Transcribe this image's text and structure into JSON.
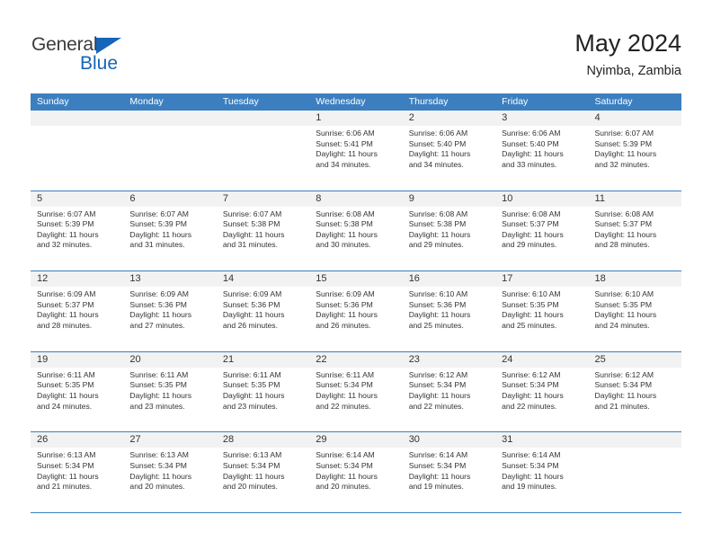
{
  "brand": {
    "name_part1": "General",
    "name_part2": "Blue",
    "accent_color": "#1565b8"
  },
  "header": {
    "title": "May 2024",
    "subtitle": "Nyimba, Zambia"
  },
  "calendar": {
    "header_bg": "#3c7fc0",
    "daynum_band_bg": "#f2f2f2",
    "weekday_names": [
      "Sunday",
      "Monday",
      "Tuesday",
      "Wednesday",
      "Thursday",
      "Friday",
      "Saturday"
    ],
    "weeks": [
      [
        {
          "day": "",
          "empty": true
        },
        {
          "day": "",
          "empty": true
        },
        {
          "day": "",
          "empty": true
        },
        {
          "day": "1",
          "sunrise": "Sunrise: 6:06 AM",
          "sunset": "Sunset: 5:41 PM",
          "daylight1": "Daylight: 11 hours",
          "daylight2": "and 34 minutes."
        },
        {
          "day": "2",
          "sunrise": "Sunrise: 6:06 AM",
          "sunset": "Sunset: 5:40 PM",
          "daylight1": "Daylight: 11 hours",
          "daylight2": "and 34 minutes."
        },
        {
          "day": "3",
          "sunrise": "Sunrise: 6:06 AM",
          "sunset": "Sunset: 5:40 PM",
          "daylight1": "Daylight: 11 hours",
          "daylight2": "and 33 minutes."
        },
        {
          "day": "4",
          "sunrise": "Sunrise: 6:07 AM",
          "sunset": "Sunset: 5:39 PM",
          "daylight1": "Daylight: 11 hours",
          "daylight2": "and 32 minutes."
        }
      ],
      [
        {
          "day": "5",
          "sunrise": "Sunrise: 6:07 AM",
          "sunset": "Sunset: 5:39 PM",
          "daylight1": "Daylight: 11 hours",
          "daylight2": "and 32 minutes."
        },
        {
          "day": "6",
          "sunrise": "Sunrise: 6:07 AM",
          "sunset": "Sunset: 5:39 PM",
          "daylight1": "Daylight: 11 hours",
          "daylight2": "and 31 minutes."
        },
        {
          "day": "7",
          "sunrise": "Sunrise: 6:07 AM",
          "sunset": "Sunset: 5:38 PM",
          "daylight1": "Daylight: 11 hours",
          "daylight2": "and 31 minutes."
        },
        {
          "day": "8",
          "sunrise": "Sunrise: 6:08 AM",
          "sunset": "Sunset: 5:38 PM",
          "daylight1": "Daylight: 11 hours",
          "daylight2": "and 30 minutes."
        },
        {
          "day": "9",
          "sunrise": "Sunrise: 6:08 AM",
          "sunset": "Sunset: 5:38 PM",
          "daylight1": "Daylight: 11 hours",
          "daylight2": "and 29 minutes."
        },
        {
          "day": "10",
          "sunrise": "Sunrise: 6:08 AM",
          "sunset": "Sunset: 5:37 PM",
          "daylight1": "Daylight: 11 hours",
          "daylight2": "and 29 minutes."
        },
        {
          "day": "11",
          "sunrise": "Sunrise: 6:08 AM",
          "sunset": "Sunset: 5:37 PM",
          "daylight1": "Daylight: 11 hours",
          "daylight2": "and 28 minutes."
        }
      ],
      [
        {
          "day": "12",
          "sunrise": "Sunrise: 6:09 AM",
          "sunset": "Sunset: 5:37 PM",
          "daylight1": "Daylight: 11 hours",
          "daylight2": "and 28 minutes."
        },
        {
          "day": "13",
          "sunrise": "Sunrise: 6:09 AM",
          "sunset": "Sunset: 5:36 PM",
          "daylight1": "Daylight: 11 hours",
          "daylight2": "and 27 minutes."
        },
        {
          "day": "14",
          "sunrise": "Sunrise: 6:09 AM",
          "sunset": "Sunset: 5:36 PM",
          "daylight1": "Daylight: 11 hours",
          "daylight2": "and 26 minutes."
        },
        {
          "day": "15",
          "sunrise": "Sunrise: 6:09 AM",
          "sunset": "Sunset: 5:36 PM",
          "daylight1": "Daylight: 11 hours",
          "daylight2": "and 26 minutes."
        },
        {
          "day": "16",
          "sunrise": "Sunrise: 6:10 AM",
          "sunset": "Sunset: 5:36 PM",
          "daylight1": "Daylight: 11 hours",
          "daylight2": "and 25 minutes."
        },
        {
          "day": "17",
          "sunrise": "Sunrise: 6:10 AM",
          "sunset": "Sunset: 5:35 PM",
          "daylight1": "Daylight: 11 hours",
          "daylight2": "and 25 minutes."
        },
        {
          "day": "18",
          "sunrise": "Sunrise: 6:10 AM",
          "sunset": "Sunset: 5:35 PM",
          "daylight1": "Daylight: 11 hours",
          "daylight2": "and 24 minutes."
        }
      ],
      [
        {
          "day": "19",
          "sunrise": "Sunrise: 6:11 AM",
          "sunset": "Sunset: 5:35 PM",
          "daylight1": "Daylight: 11 hours",
          "daylight2": "and 24 minutes."
        },
        {
          "day": "20",
          "sunrise": "Sunrise: 6:11 AM",
          "sunset": "Sunset: 5:35 PM",
          "daylight1": "Daylight: 11 hours",
          "daylight2": "and 23 minutes."
        },
        {
          "day": "21",
          "sunrise": "Sunrise: 6:11 AM",
          "sunset": "Sunset: 5:35 PM",
          "daylight1": "Daylight: 11 hours",
          "daylight2": "and 23 minutes."
        },
        {
          "day": "22",
          "sunrise": "Sunrise: 6:11 AM",
          "sunset": "Sunset: 5:34 PM",
          "daylight1": "Daylight: 11 hours",
          "daylight2": "and 22 minutes."
        },
        {
          "day": "23",
          "sunrise": "Sunrise: 6:12 AM",
          "sunset": "Sunset: 5:34 PM",
          "daylight1": "Daylight: 11 hours",
          "daylight2": "and 22 minutes."
        },
        {
          "day": "24",
          "sunrise": "Sunrise: 6:12 AM",
          "sunset": "Sunset: 5:34 PM",
          "daylight1": "Daylight: 11 hours",
          "daylight2": "and 22 minutes."
        },
        {
          "day": "25",
          "sunrise": "Sunrise: 6:12 AM",
          "sunset": "Sunset: 5:34 PM",
          "daylight1": "Daylight: 11 hours",
          "daylight2": "and 21 minutes."
        }
      ],
      [
        {
          "day": "26",
          "sunrise": "Sunrise: 6:13 AM",
          "sunset": "Sunset: 5:34 PM",
          "daylight1": "Daylight: 11 hours",
          "daylight2": "and 21 minutes."
        },
        {
          "day": "27",
          "sunrise": "Sunrise: 6:13 AM",
          "sunset": "Sunset: 5:34 PM",
          "daylight1": "Daylight: 11 hours",
          "daylight2": "and 20 minutes."
        },
        {
          "day": "28",
          "sunrise": "Sunrise: 6:13 AM",
          "sunset": "Sunset: 5:34 PM",
          "daylight1": "Daylight: 11 hours",
          "daylight2": "and 20 minutes."
        },
        {
          "day": "29",
          "sunrise": "Sunrise: 6:14 AM",
          "sunset": "Sunset: 5:34 PM",
          "daylight1": "Daylight: 11 hours",
          "daylight2": "and 20 minutes."
        },
        {
          "day": "30",
          "sunrise": "Sunrise: 6:14 AM",
          "sunset": "Sunset: 5:34 PM",
          "daylight1": "Daylight: 11 hours",
          "daylight2": "and 19 minutes."
        },
        {
          "day": "31",
          "sunrise": "Sunrise: 6:14 AM",
          "sunset": "Sunset: 5:34 PM",
          "daylight1": "Daylight: 11 hours",
          "daylight2": "and 19 minutes."
        },
        {
          "day": "",
          "empty": true
        }
      ]
    ]
  }
}
